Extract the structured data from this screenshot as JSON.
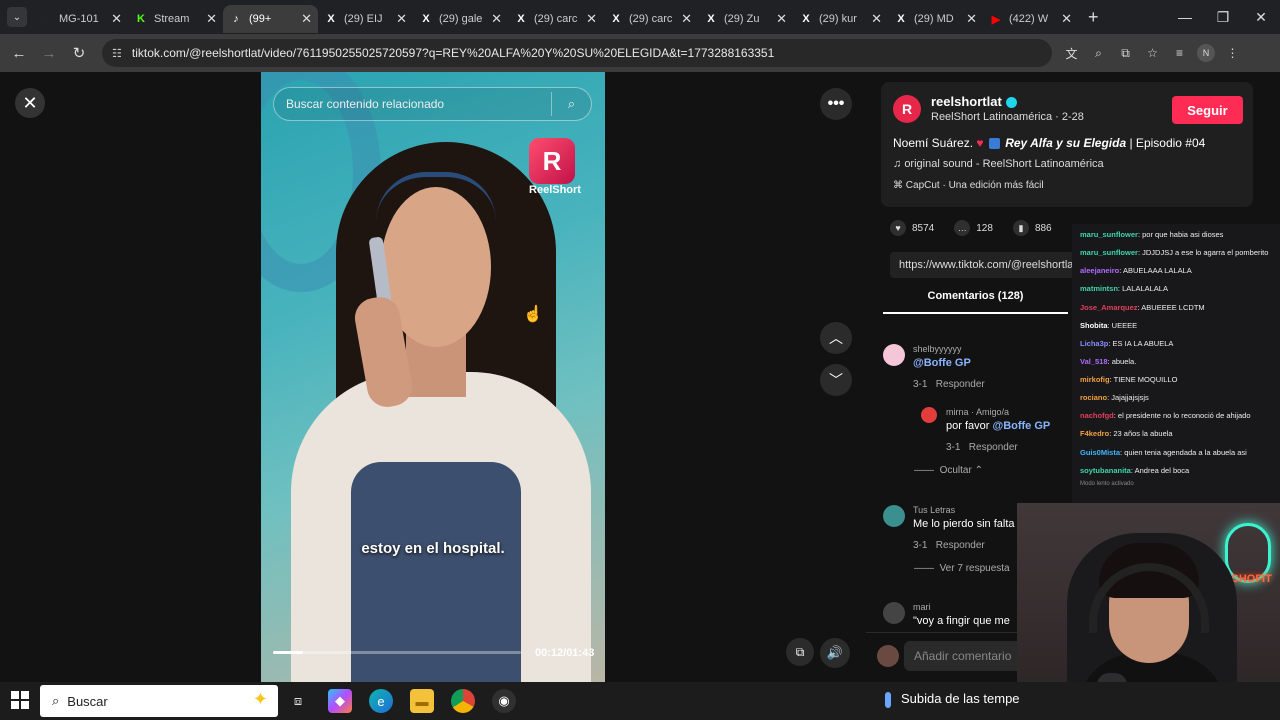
{
  "browser": {
    "tabs": [
      {
        "label": "MG-101",
        "icon": "gmail-icon",
        "color": "#222"
      },
      {
        "label": "Stream",
        "icon": "kick-icon",
        "color": "#53fc18"
      },
      {
        "label": "(99+",
        "icon": "tiktok-icon",
        "color": "#fff",
        "active": true
      },
      {
        "label": "(29) EIJ",
        "icon": "x-icon",
        "color": "#fff"
      },
      {
        "label": "(29) gale",
        "icon": "x-icon",
        "color": "#fff"
      },
      {
        "label": "(29) carc",
        "icon": "x-icon",
        "color": "#fff"
      },
      {
        "label": "(29) carc",
        "icon": "x-icon",
        "color": "#fff"
      },
      {
        "label": "(29) Zu",
        "icon": "x-icon",
        "color": "#fff"
      },
      {
        "label": "(29) kur",
        "icon": "x-icon",
        "color": "#fff"
      },
      {
        "label": "(29) MD",
        "icon": "x-icon",
        "color": "#fff"
      },
      {
        "label": "(422) W",
        "icon": "youtube-icon",
        "color": "#ff0000"
      }
    ],
    "url": "tiktok.com/@reelshortlat/video/7611950255025720597?q=REY%20ALFA%20Y%20SU%20ELEGIDA&t=1773288163351"
  },
  "video": {
    "search_placeholder": "Buscar contenido relacionado",
    "logo_letter": "R",
    "brand": "ReelShort",
    "subtitle": "estoy en el hospital.",
    "time": "00:12/01:43",
    "progress_fraction": 0.12
  },
  "author": {
    "avatar_letter": "R",
    "username": "reelshortlat",
    "subline": "ReelShort Latinoamérica · 2-28",
    "follow_label": "Seguir",
    "desc_prefix": "Noemí Suárez.",
    "desc_title": "Rey Alfa y su Elegida",
    "desc_suffix": "| Episodio #04",
    "sound": "original sound - ReelShort Latinoamérica",
    "capcut": "CapCut · Una edición más fácil"
  },
  "stats": {
    "likes": "8574",
    "comments": "128",
    "saves": "886"
  },
  "link": "https://www.tiktok.com/@reelshortlat",
  "comments_tab": "Comentarios (128)",
  "comments": [
    {
      "name": "shelbyyyyyy",
      "mention": "@Boffe GP",
      "text": "",
      "date": "3-1",
      "reply": "Responder",
      "avatar_color": "#f4c6d8"
    },
    {
      "name": "mirna · Amigo/a",
      "prefix": "por favor ",
      "mention": "@Boffe GP",
      "date": "3-1",
      "reply": "Responder",
      "avatar_color": "#e23d3d"
    },
    {
      "name": "Tus Letras",
      "text": "Me lo pierdo sin falta",
      "date": "3-1",
      "reply": "Responder",
      "avatar_color": "#3b8f8f"
    },
    {
      "name": "mari",
      "text": "\"voy a fingir que me",
      "avatar_color": "#444"
    }
  ],
  "hide_replies": "Ocultar",
  "view_replies": "Ver 7 respuesta",
  "add_comment_placeholder": "Añadir comentario",
  "chat": [
    {
      "user": "maru_sunflower",
      "color": "#3fd6a6",
      "msg": "por que habia asi dioses"
    },
    {
      "user": "maru_sunflower",
      "color": "#3fd6a6",
      "msg": "JDJDJSJ a ese lo agarra el pomberito"
    },
    {
      "user": "aleejaneiro",
      "color": "#b06bff",
      "msg": "ABUELAAA LALALA"
    },
    {
      "user": "matmintsn",
      "color": "#3fd6a6",
      "msg": "LALALALALA"
    },
    {
      "user": "Jose_Amarquez",
      "color": "#e0405a",
      "msg": "ABUEEEE LCDTM"
    },
    {
      "user": "Shobita",
      "color": "#ffffff",
      "msg": "UEEEE"
    },
    {
      "user": "Licha3p",
      "color": "#8a8aff",
      "msg": "ES IA LA ABUELA"
    },
    {
      "user": "Val_518",
      "color": "#b06bff",
      "msg": "abuela."
    },
    {
      "user": "mirkofig",
      "color": "#f0a040",
      "msg": "TIENE MOQUILLO"
    },
    {
      "user": "rociano",
      "color": "#f0a040",
      "msg": "Jajajjajsjsjs"
    },
    {
      "user": "nachofgd",
      "color": "#e0405a",
      "msg": "el presidente no lo reconoció de ahijado"
    },
    {
      "user": "F4kedro",
      "color": "#f0a040",
      "msg": "23 años la abuela"
    },
    {
      "user": "Guis0Mista",
      "color": "#3fb6ff",
      "msg": "quien tenia agendada a la abuela asi"
    },
    {
      "user": "soytubananita",
      "color": "#3fd6a6",
      "msg": "Andrea del boca"
    }
  ],
  "chat_mode": "Modo lento activado",
  "cam_sign": "NACHOFIT",
  "taskbar": {
    "search_placeholder": "Buscar",
    "status": "Subida de las tempe"
  }
}
